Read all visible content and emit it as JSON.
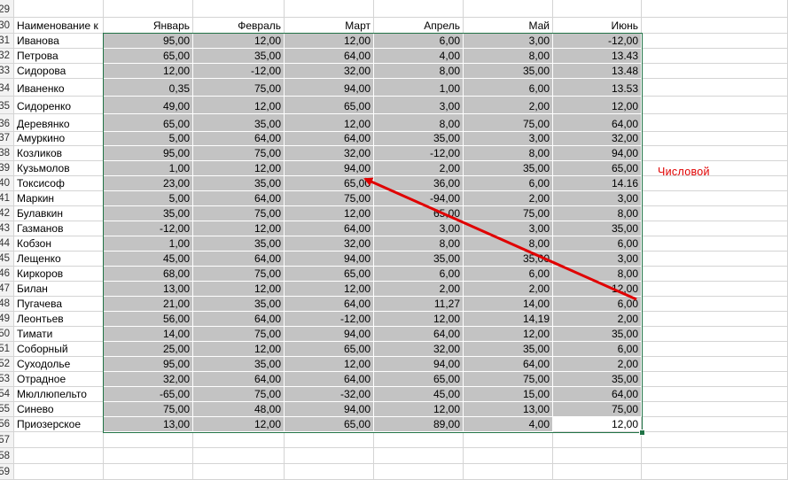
{
  "header": {
    "row_number": "30",
    "columns": [
      "Наименование к",
      "Январь",
      "Февраль",
      "Март",
      "Апрель",
      "Май",
      "Июнь"
    ]
  },
  "top_row_number": "29",
  "rows": [
    {
      "n": "31",
      "name": "Иванова",
      "v": [
        "95,00",
        "12,00",
        "12,00",
        "6,00",
        "3,00",
        "-12,00"
      ]
    },
    {
      "n": "32",
      "name": "Петрова",
      "v": [
        "65,00",
        "35,00",
        "64,00",
        "4,00",
        "8,00",
        "13.43"
      ]
    },
    {
      "n": "33",
      "name": "Сидорова",
      "v": [
        "12,00",
        "-12,00",
        "32,00",
        "8,00",
        "35,00",
        "13.48"
      ]
    },
    {
      "n": "34",
      "name": "Иваненко",
      "v": [
        "0,35",
        "75,00",
        "94,00",
        "1,00",
        "6,00",
        "13.53"
      ]
    },
    {
      "n": "35",
      "name": "Сидоренко",
      "v": [
        "49,00",
        "12,00",
        "65,00",
        "3,00",
        "2,00",
        "12,00"
      ]
    },
    {
      "n": "36",
      "name": "Деревянко",
      "v": [
        "65,00",
        "35,00",
        "12,00",
        "8,00",
        "75,00",
        "64,00"
      ]
    },
    {
      "n": "37",
      "name": "Амуркино",
      "v": [
        "5,00",
        "64,00",
        "64,00",
        "35,00",
        "3,00",
        "32,00"
      ]
    },
    {
      "n": "38",
      "name": "Козликов",
      "v": [
        "95,00",
        "75,00",
        "32,00",
        "-12,00",
        "8,00",
        "94,00"
      ]
    },
    {
      "n": "39",
      "name": "Кузьмолов",
      "v": [
        "1,00",
        "12,00",
        "94,00",
        "2,00",
        "35,00",
        "65,00"
      ]
    },
    {
      "n": "40",
      "name": "Токсисоф",
      "v": [
        "23,00",
        "35,00",
        "65,00",
        "36,00",
        "6,00",
        "14.16"
      ]
    },
    {
      "n": "41",
      "name": "Маркин",
      "v": [
        "5,00",
        "64,00",
        "75,00",
        "-94,00",
        "2,00",
        "3,00"
      ]
    },
    {
      "n": "42",
      "name": "Булавкин",
      "v": [
        "35,00",
        "75,00",
        "12,00",
        "65,00",
        "75,00",
        "8,00"
      ]
    },
    {
      "n": "43",
      "name": "Газманов",
      "v": [
        "-12,00",
        "12,00",
        "64,00",
        "3,00",
        "3,00",
        "35,00"
      ]
    },
    {
      "n": "44",
      "name": "Кобзон",
      "v": [
        "1,00",
        "35,00",
        "32,00",
        "8,00",
        "8,00",
        "6,00"
      ]
    },
    {
      "n": "45",
      "name": "Лещенко",
      "v": [
        "45,00",
        "64,00",
        "94,00",
        "35,00",
        "35,00",
        "3,00"
      ]
    },
    {
      "n": "46",
      "name": "Киркоров",
      "v": [
        "68,00",
        "75,00",
        "65,00",
        "6,00",
        "6,00",
        "8,00"
      ]
    },
    {
      "n": "47",
      "name": "Билан",
      "v": [
        "13,00",
        "12,00",
        "12,00",
        "2,00",
        "2,00",
        "12,00"
      ]
    },
    {
      "n": "48",
      "name": "Пугачева",
      "v": [
        "21,00",
        "35,00",
        "64,00",
        "11,27",
        "14,00",
        "6,00"
      ]
    },
    {
      "n": "49",
      "name": "Леонтьев",
      "v": [
        "56,00",
        "64,00",
        "-12,00",
        "12,00",
        "14,19",
        "2,00"
      ]
    },
    {
      "n": "50",
      "name": "Тимати",
      "v": [
        "14,00",
        "75,00",
        "94,00",
        "64,00",
        "12,00",
        "35,00"
      ]
    },
    {
      "n": "51",
      "name": "Соборный",
      "v": [
        "25,00",
        "12,00",
        "65,00",
        "32,00",
        "35,00",
        "6,00"
      ]
    },
    {
      "n": "52",
      "name": "Суходолье",
      "v": [
        "95,00",
        "35,00",
        "12,00",
        "94,00",
        "64,00",
        "2,00"
      ]
    },
    {
      "n": "53",
      "name": "Отрадное",
      "v": [
        "32,00",
        "64,00",
        "64,00",
        "65,00",
        "75,00",
        "35,00"
      ]
    },
    {
      "n": "54",
      "name": "Мюллюпельто",
      "v": [
        "-65,00",
        "75,00",
        "-32,00",
        "45,00",
        "15,00",
        "64,00"
      ]
    },
    {
      "n": "55",
      "name": "Синево",
      "v": [
        "75,00",
        "48,00",
        "94,00",
        "12,00",
        "13,00",
        "75,00"
      ]
    },
    {
      "n": "56",
      "name": "Приозерское",
      "v": [
        "13,00",
        "12,00",
        "65,00",
        "89,00",
        "4,00",
        "12,00"
      ]
    }
  ],
  "empty_rows": [
    "57",
    "58",
    "59"
  ],
  "annotation": {
    "text": "Числовой",
    "color": "#e00000"
  },
  "colors": {
    "shade": "#c3c3c3",
    "selection_border": "#217346",
    "arrow": "#e00000",
    "gridline": "#d4d4d4"
  }
}
